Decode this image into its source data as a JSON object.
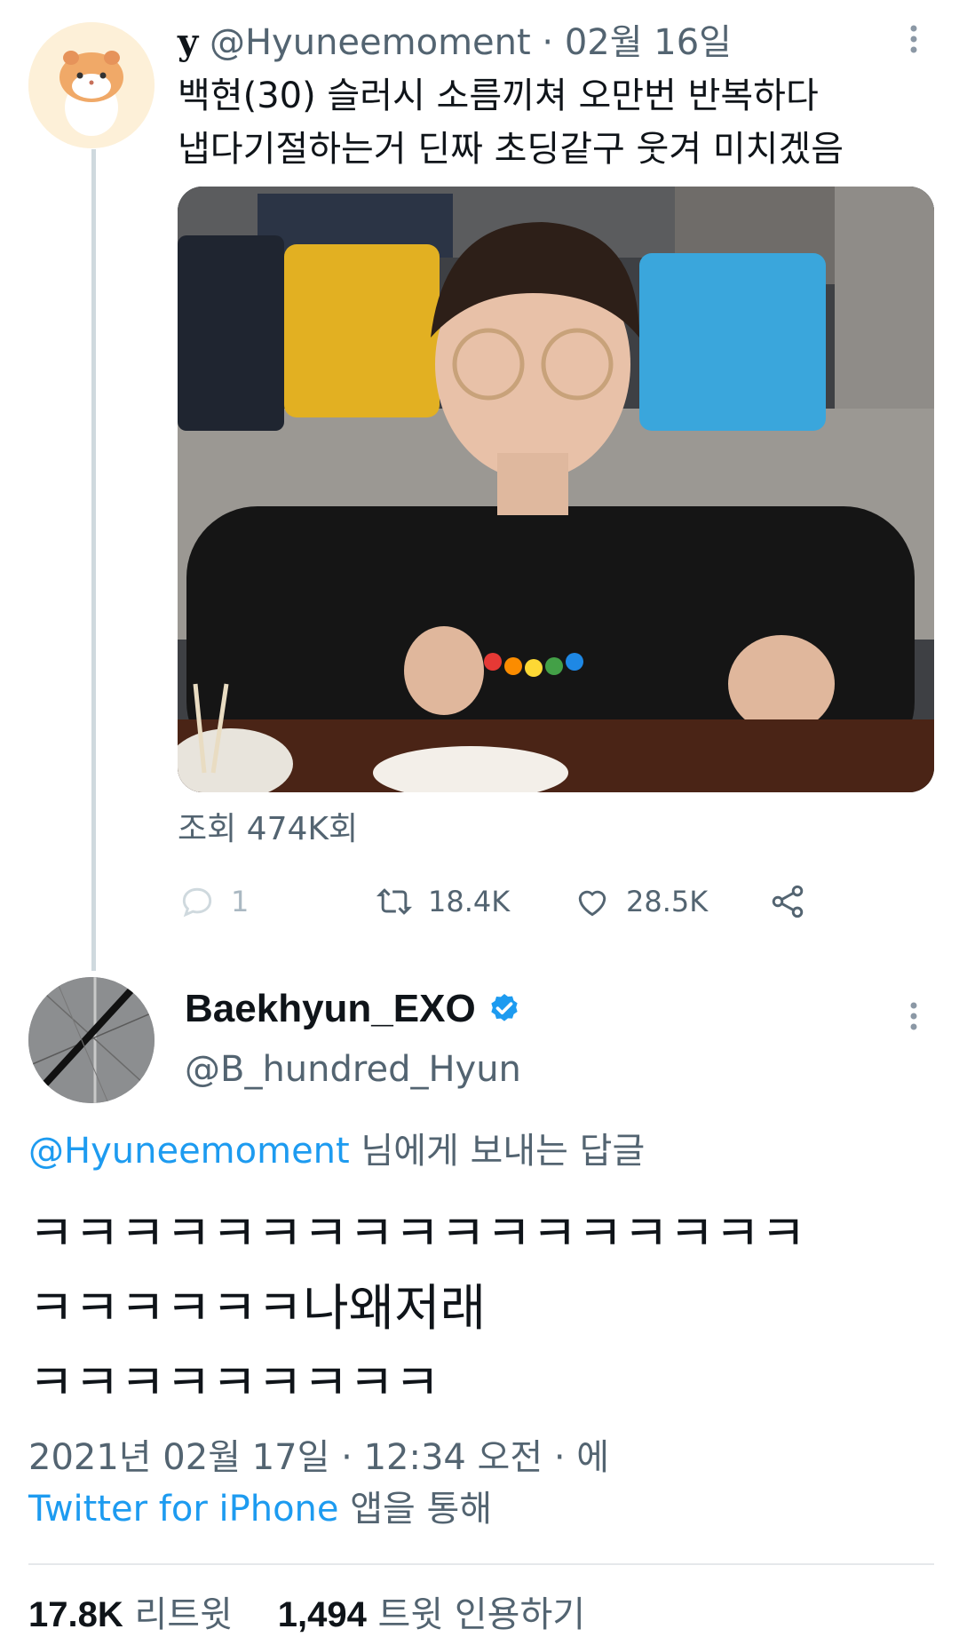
{
  "parent_tweet": {
    "display_name": "y",
    "handle": "@Hyuneemoment",
    "separator": "·",
    "date": "02월 16일",
    "text_lines": [
      "백현(30) 슬러시 소름끼쳐 오만번 반복하다",
      "냅다기절하는거 딘짜 초딩같구 웃겨 미치겠음"
    ],
    "views": "조회 474K회",
    "actions": {
      "replies": "1",
      "retweets": "18.4K",
      "likes": "28.5K"
    },
    "icons": {
      "more": "more-vertical-icon",
      "reply": "reply-bubble-icon",
      "retweet": "retweet-icon",
      "like": "heart-icon",
      "share": "share-icon"
    }
  },
  "reply_tweet": {
    "display_name": "Baekhyun_EXO",
    "verified": true,
    "handle": "@B_hundred_Hyun",
    "reply_to_mention": "@Hyuneemoment",
    "reply_to_suffix": " 님에게 보내는 답글",
    "text_lines": [
      "ㅋㅋㅋㅋㅋㅋㅋㅋㅋㅋㅋㅋㅋㅋㅋㅋㅋ",
      "ㅋㅋㅋㅋㅋㅋ나왜저래",
      "ㅋㅋㅋㅋㅋㅋㅋㅋㅋ"
    ],
    "timestamp": "2021년 02월 17일 · 12:34 오전 · 에",
    "source_app": "Twitter for iPhone",
    "source_suffix": " 앱을 통해",
    "stats": {
      "retweets_count": "17.8K",
      "retweets_label": " 리트윗",
      "quotes_count": "1,494",
      "quotes_label": " 트윗 인용하기"
    }
  },
  "colors": {
    "accent": "#1d9bf0",
    "secondary_text": "#536471",
    "primary_text": "#0f1419",
    "thread_line": "#cfd9de"
  }
}
